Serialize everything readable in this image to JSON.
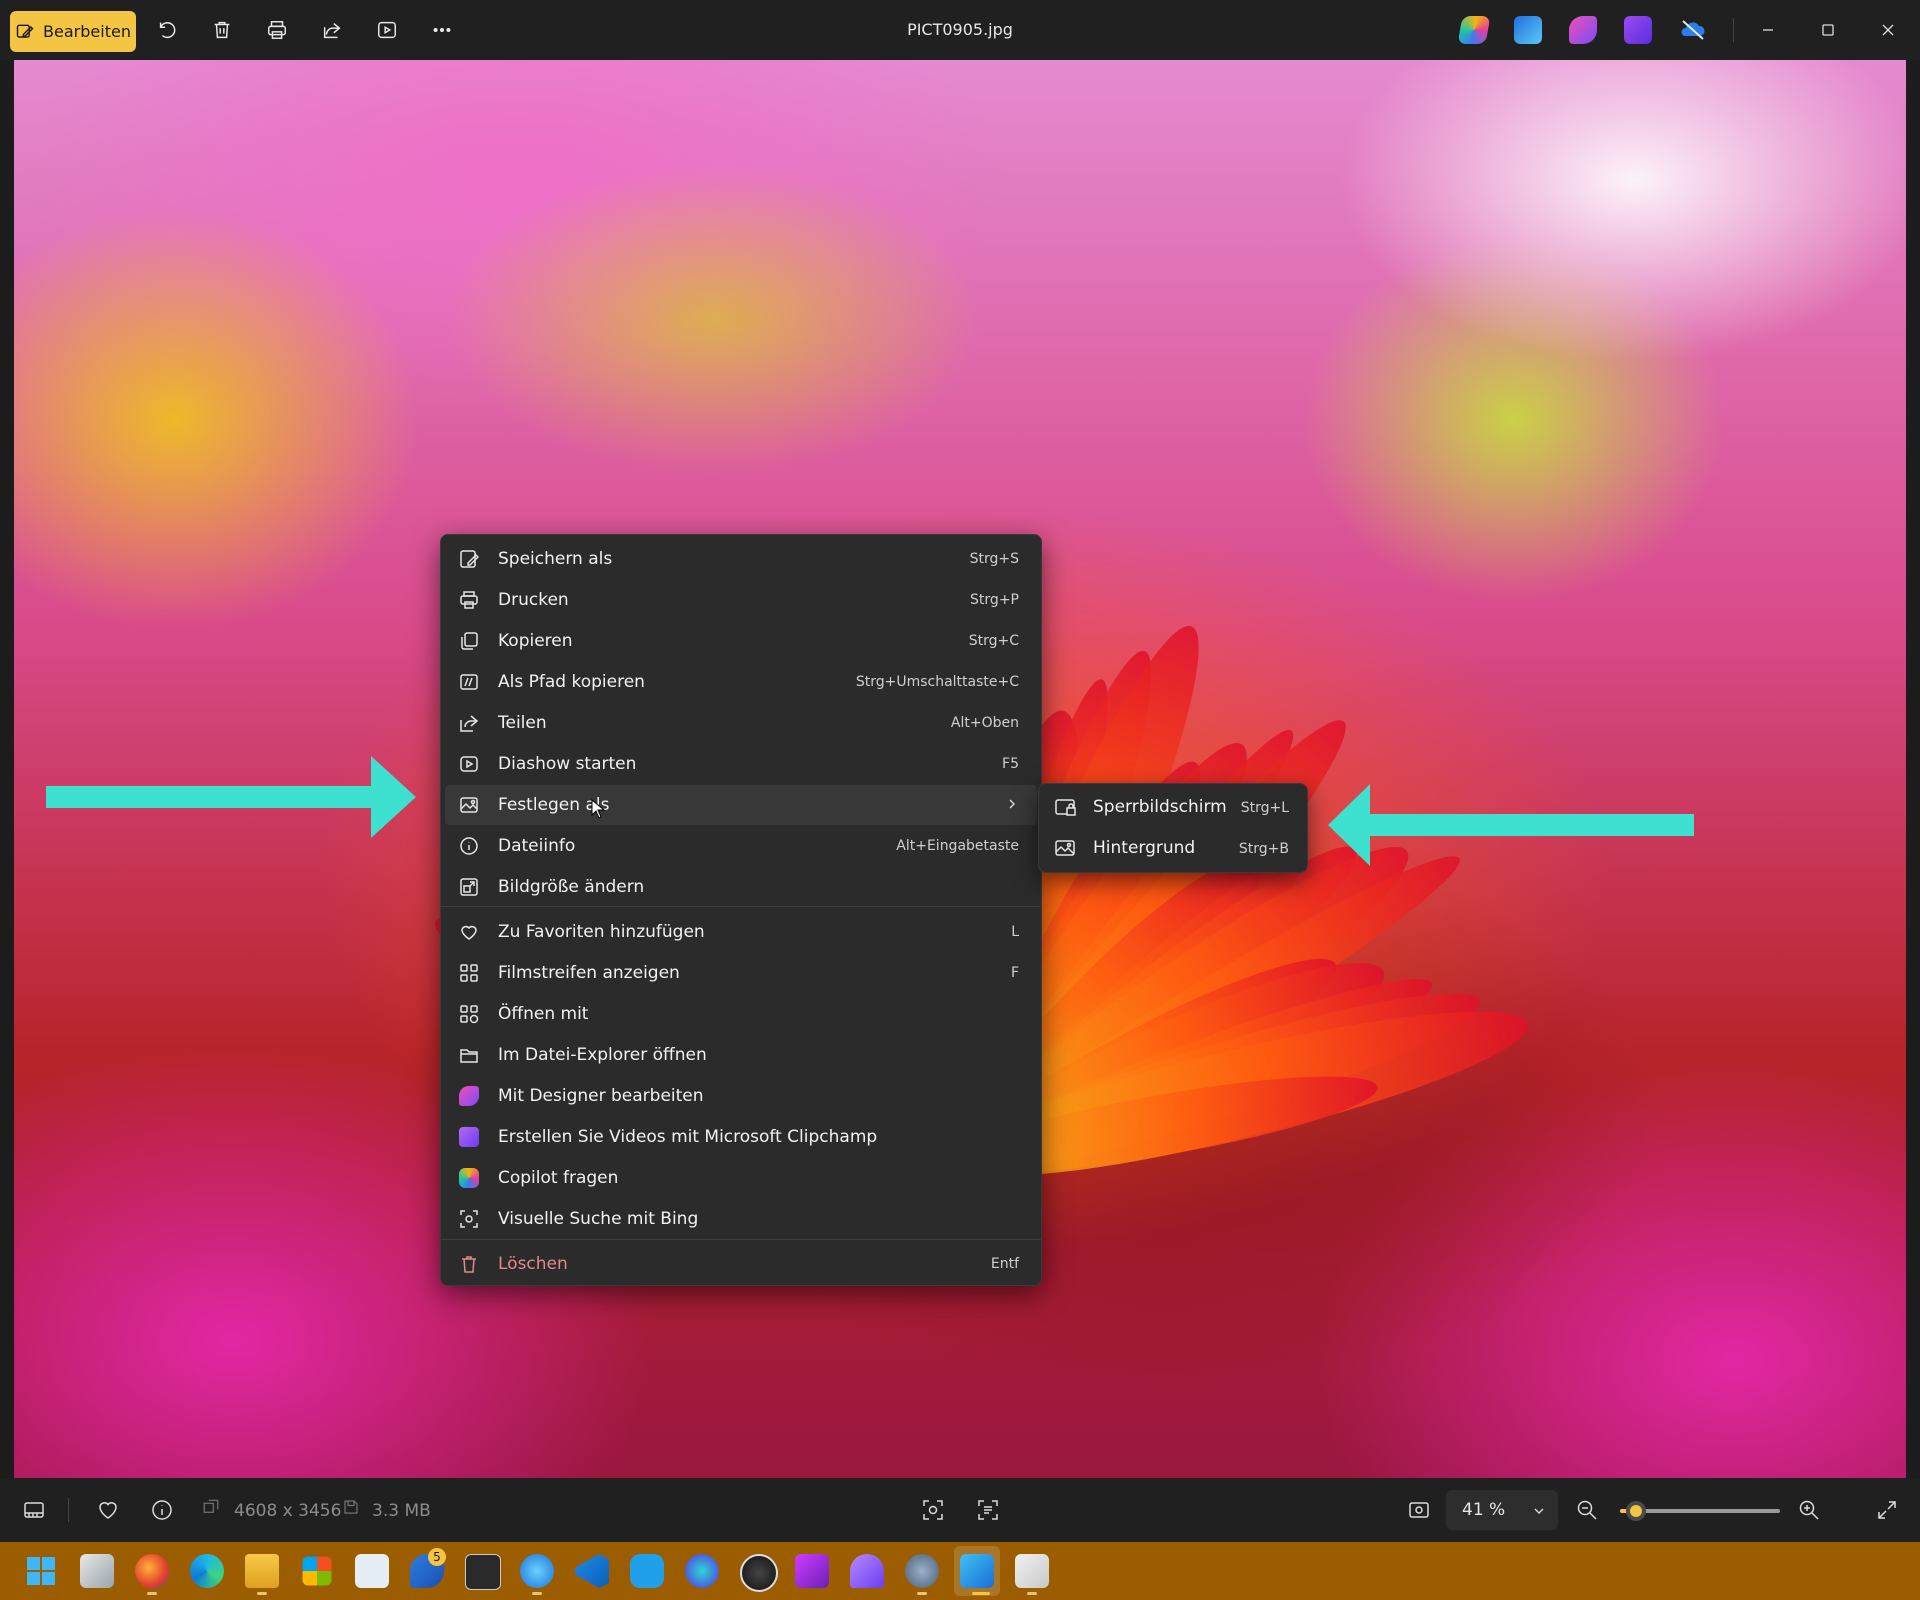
{
  "window": {
    "title": "PICT0905.jpg",
    "edit_label": "Bearbeiten"
  },
  "context_menu": {
    "items": [
      {
        "label": "Speichern als",
        "shortcut": "Strg+S"
      },
      {
        "label": "Drucken",
        "shortcut": "Strg+P"
      },
      {
        "label": "Kopieren",
        "shortcut": "Strg+C"
      },
      {
        "label": "Als Pfad kopieren",
        "shortcut": "Strg+Umschalttaste+C"
      },
      {
        "label": "Teilen",
        "shortcut": "Alt+Oben"
      },
      {
        "label": "Diashow starten",
        "shortcut": "F5"
      },
      {
        "label": "Festlegen als",
        "shortcut": ""
      },
      {
        "label": "Dateiinfo",
        "shortcut": "Alt+Eingabetaste"
      },
      {
        "label": "Bildgröße ändern",
        "shortcut": ""
      },
      {
        "label": "Zu Favoriten hinzufügen",
        "shortcut": "L"
      },
      {
        "label": "Filmstreifen anzeigen",
        "shortcut": "F"
      },
      {
        "label": "Öffnen mit",
        "shortcut": ""
      },
      {
        "label": "Im Datei-Explorer öffnen",
        "shortcut": ""
      },
      {
        "label": "Mit Designer bearbeiten",
        "shortcut": ""
      },
      {
        "label": "Erstellen Sie Videos mit Microsoft Clipchamp",
        "shortcut": ""
      },
      {
        "label": "Copilot fragen",
        "shortcut": ""
      },
      {
        "label": "Visuelle Suche mit Bing",
        "shortcut": ""
      },
      {
        "label": "Löschen",
        "shortcut": "Entf"
      }
    ]
  },
  "submenu": {
    "items": [
      {
        "label": "Sperrbildschirm",
        "shortcut": "Strg+L"
      },
      {
        "label": "Hintergrund",
        "shortcut": "Strg+B"
      }
    ]
  },
  "status": {
    "dimensions": "4608 x 3456",
    "file_size": "3.3 MB",
    "zoom": "41 %",
    "zoom_fraction": 0.1
  },
  "taskbar": {
    "badge_count": "5"
  },
  "colors": {
    "accent": "#f4c542",
    "arrow": "#3ee0d0",
    "taskbar": "#9b5d00"
  }
}
